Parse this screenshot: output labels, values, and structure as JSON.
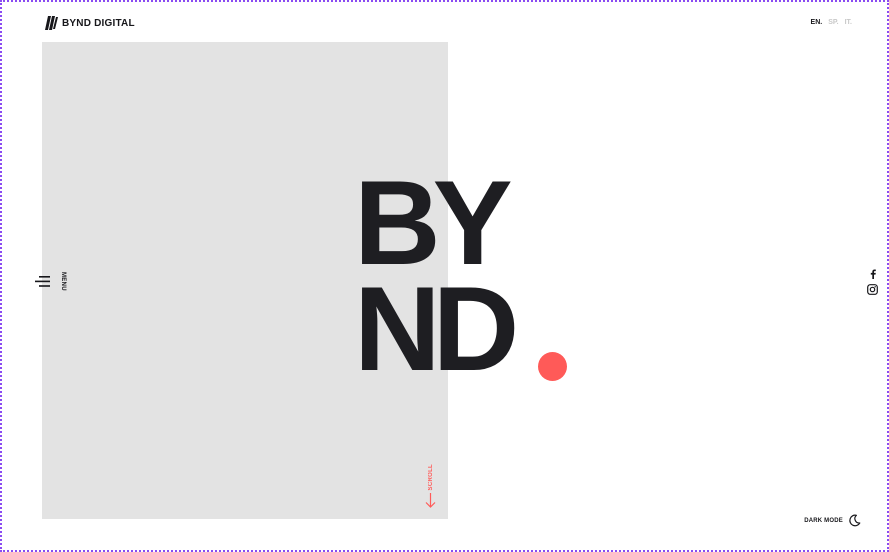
{
  "header": {
    "logo_text": "BYND DIGITAL",
    "languages": [
      "EN.",
      "SP.",
      "IT."
    ],
    "active_language": "EN."
  },
  "hero": {
    "line1": "BY",
    "line2": "ND"
  },
  "menu": {
    "label": "MENU",
    "icon": "hamburger-icon"
  },
  "scroll": {
    "label": "SCROLL",
    "icon": "arrow-down-icon"
  },
  "social": {
    "icons": [
      "facebook-icon",
      "instagram-icon"
    ]
  },
  "footer": {
    "dark_mode_label": "DARK MODE",
    "dark_mode_icon": "moon-icon"
  },
  "colors": {
    "accent": "#ff5a58",
    "text": "#17171b",
    "panel": "#e3e3e3",
    "border": "#8a4bf2"
  }
}
